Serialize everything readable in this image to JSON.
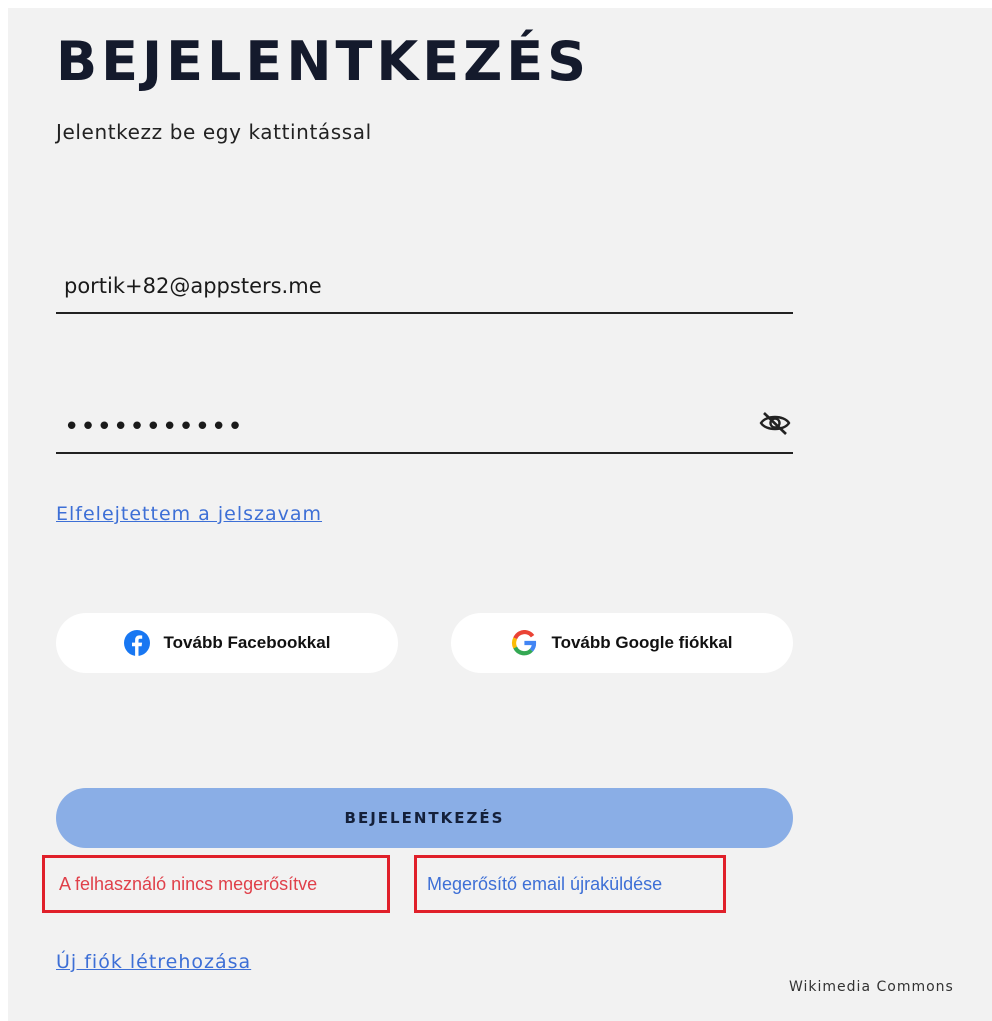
{
  "login": {
    "title": "BEJELENTKEZÉS",
    "subtitle": "Jelentkezz be egy kattintással",
    "email_value": "portik+82@appsters.me",
    "password_value": "•••••••••••",
    "forgot_password_link": "Elfelejtettem a jelszavam",
    "facebook_button": "Tovább Facebookkal",
    "google_button": "Tovább Google fiókkal",
    "submit_button": "BEJELENTKEZÉS",
    "error_message": "A felhasználó nincs megerősítve",
    "resend_link": "Megerősítő email újraküldése",
    "create_account_link": "Új fiók létrehozása"
  },
  "icons": {
    "password_toggle": "eye-slash-icon",
    "facebook": "facebook-icon",
    "google": "google-icon"
  },
  "colors": {
    "background": "#f2f2f2",
    "link": "#3d6fd6",
    "submit_button": "#8aaee6",
    "error_text": "#e0404a",
    "highlight_box": "#e0202a",
    "title": "#141a2c"
  },
  "watermark": "Wikimedia Commons"
}
